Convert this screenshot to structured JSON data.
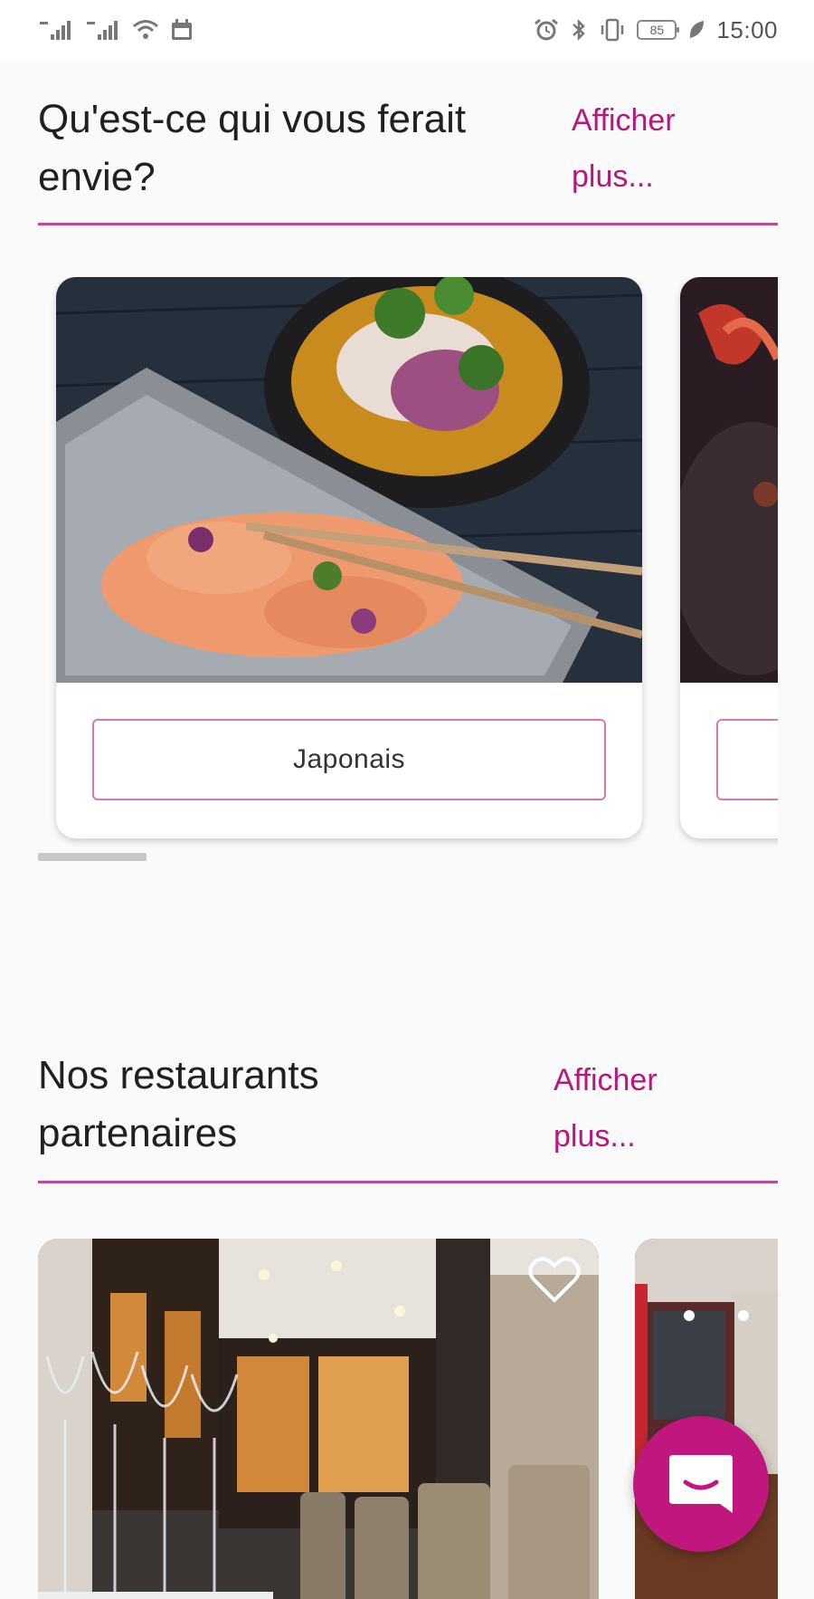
{
  "status_bar": {
    "left_icons": [
      "signal-icon",
      "signal-icon",
      "wifi-icon",
      "calendar-icon"
    ],
    "right_icons": [
      "alarm-icon",
      "bluetooth-icon",
      "vibrate-icon",
      "battery-icon",
      "leaf-icon"
    ],
    "battery_level": "85",
    "time": "15:00"
  },
  "categories_section": {
    "title": "Qu'est-ce qui vous ferait envie?",
    "more_label": "Afficher plus...",
    "accent_color": "#b5177f",
    "cards": [
      {
        "label": "Japonais",
        "image": "japanese-food-photo"
      },
      {
        "label": "",
        "image": "food-photo"
      }
    ]
  },
  "restaurants_section": {
    "title": "Nos restaurants partenaires",
    "more_label": "Afficher plus...",
    "cards": [
      {
        "image": "restaurant-interior-photo",
        "favorite_icon": "heart-outline-icon"
      },
      {
        "image": "restaurant-interior-photo"
      }
    ]
  },
  "fab": {
    "icon": "chat-icon",
    "color": "#c0177f"
  }
}
